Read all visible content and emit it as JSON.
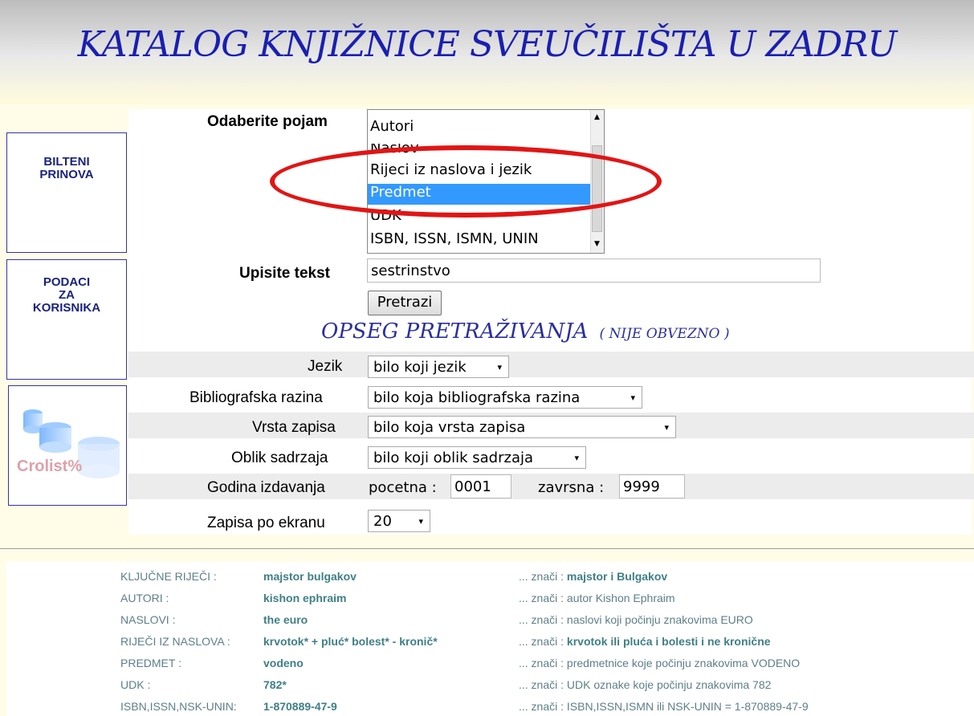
{
  "header": {
    "title": "KATALOG KNJIŽNICE SVEUČILIŠTA U ZADRU"
  },
  "sidebar": {
    "bilteni": [
      "BILTENI",
      "PRINOVA"
    ],
    "podaci": [
      "PODACI",
      "ZA",
      "KORISNIKA"
    ],
    "crolist_logo": "Crolist%"
  },
  "search": {
    "pojam_label": "Odaberite pojam",
    "pojam_options": [
      "Autori",
      "Naslov",
      "Rijeci iz naslova i jezik",
      "Predmet",
      "UDK",
      "ISBN, ISSN, ISMN, UNIN"
    ],
    "pojam_selected": "Predmet",
    "tekst_label": "Upisite tekst",
    "tekst_value": "sestrinstvo",
    "button": "Pretrazi"
  },
  "scope": {
    "title": "OPSEG PRETRAŽIVANJA",
    "subtitle": "( NIJE OBVEZNO )",
    "jezik_label": "Jezik",
    "jezik_value": "bilo koji jezik",
    "razina_label": "Bibliografska razina",
    "razina_value": "bilo koja bibliografska razina",
    "vrsta_label": "Vrsta zapisa",
    "vrsta_value": "bilo koja vrsta zapisa",
    "oblik_label": "Oblik sadrzaja",
    "oblik_value": "bilo koji oblik sadrzaja",
    "godina_label": "Godina izdavanja",
    "pocetna_label": "pocetna :",
    "pocetna_value": "0001",
    "zavrsna_label": "zavrsna :",
    "zavrsna_value": "9999",
    "zapisa_label": "Zapisa po ekranu",
    "zapisa_value": "20"
  },
  "help": {
    "rows": [
      {
        "key": "KLJUČNE RIJEČI :",
        "example": "majstor bulgakov",
        "meaning_prefix": "... znači :",
        "meaning": "majstor i Bulgakov"
      },
      {
        "key": "AUTORI :",
        "example": "kishon ephraim",
        "meaning_prefix": "... znači :",
        "meaning": "autor Kishon Ephraim"
      },
      {
        "key": "NASLOVI :",
        "example": "the euro",
        "meaning_prefix": "... znači :",
        "meaning": "naslovi koji počinju znakovima EURO"
      },
      {
        "key": "RIJEČI IZ NASLOVA :",
        "example": "krvotok* + pluć* bolest* - kronič*",
        "meaning_prefix": "... znači :",
        "meaning": "krvotok ili pluća i bolesti i ne kronične"
      },
      {
        "key": "PREDMET :",
        "example": "vodeno",
        "meaning_prefix": "... znači :",
        "meaning": "predmetnice koje počinju znakovima VODENO"
      },
      {
        "key": "UDK :",
        "example": "782*",
        "meaning_prefix": "... znači :",
        "meaning": "UDK oznake koje počinju znakovima 782"
      },
      {
        "key": "ISBN,ISSN,NSK-UNIN:",
        "example": "1-870889-47-9",
        "meaning_prefix": "... znači :",
        "meaning": "ISBN,ISSN,ISMN ili NSK-UNIN = 1-870889-47-9"
      }
    ]
  }
}
